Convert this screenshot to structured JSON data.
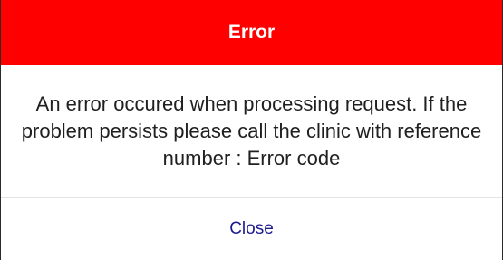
{
  "dialog": {
    "title": "Error",
    "message": "An error occured when processing request. If the problem persists please call the clinic with reference number : Error code",
    "close_label": "Close"
  },
  "colors": {
    "header_background": "#fe0000",
    "header_text": "#ffffff",
    "button_text": "#1a1a8f",
    "divider": "#e3e3e3"
  }
}
